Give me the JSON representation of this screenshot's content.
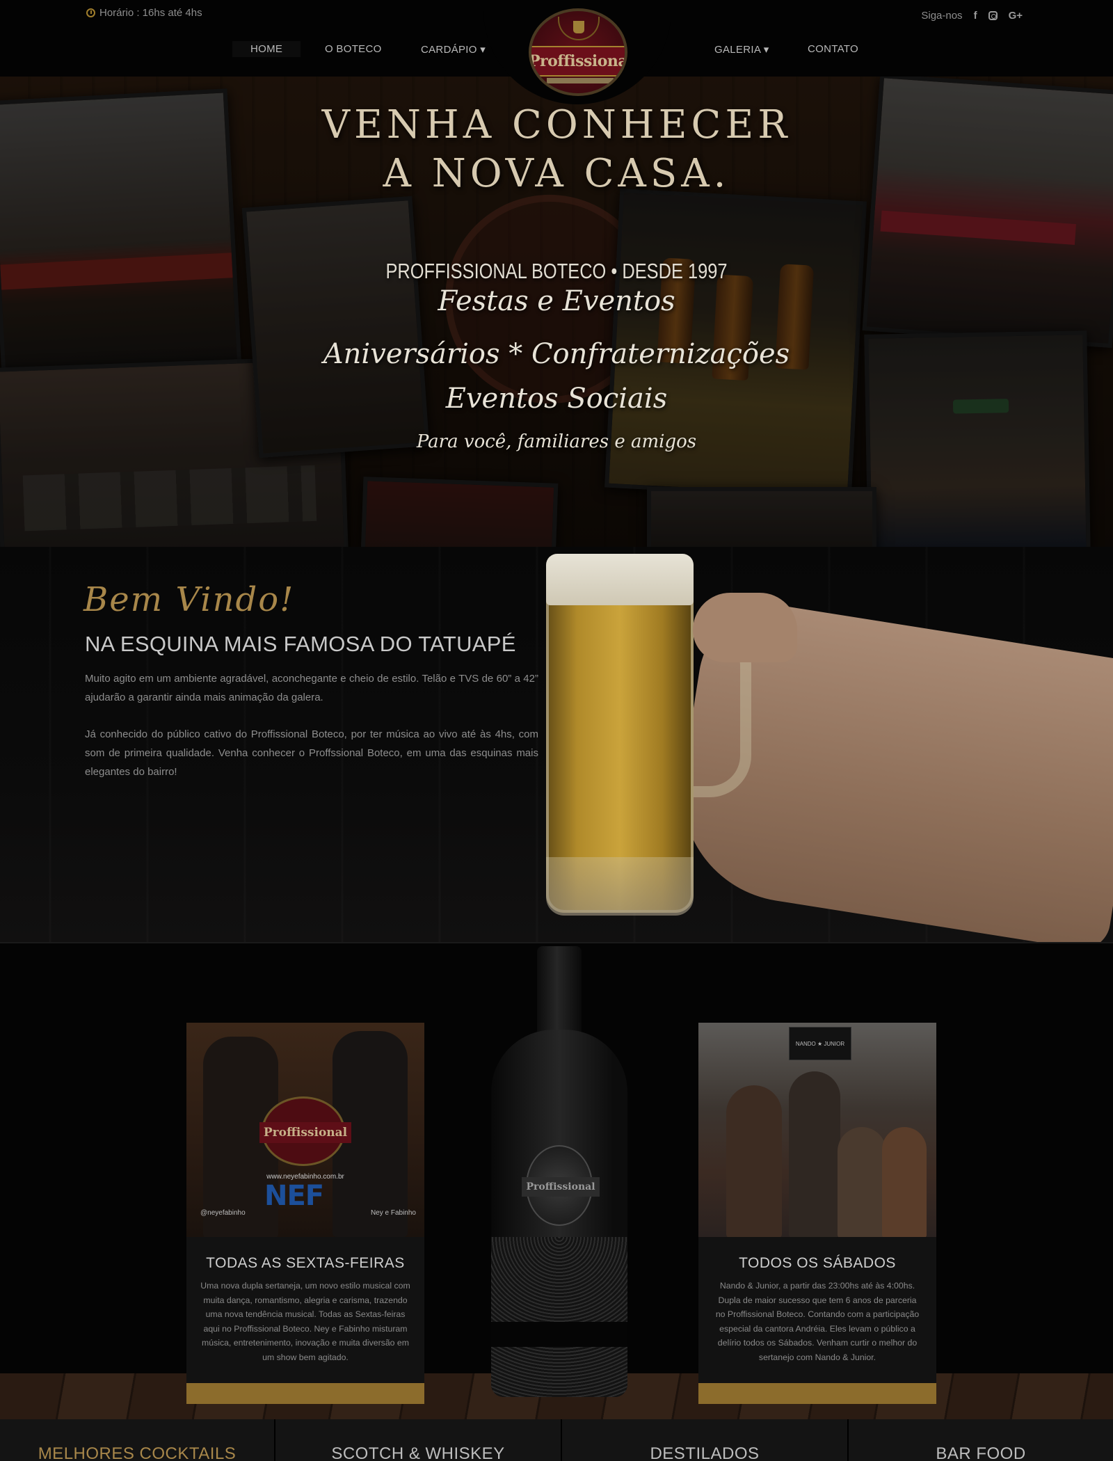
{
  "header": {
    "hours": "Horário : 16hs até 4hs",
    "follow_label": "Siga-nos",
    "nav": [
      "HOME",
      "O BOTECO",
      "CARDÁPIO ▾",
      "GALERIA ▾",
      "CONTATO"
    ],
    "logo_text": "Proffissional"
  },
  "hero": {
    "title_line1": "VENHA CONHECER",
    "title_line2": "A NOVA CASA.",
    "subtitle": "PROFFISSIONAL BOTECO • DESDE 1997",
    "script_line1": "Festas e Eventos",
    "script_line2": "Aniversários * Confraternizações",
    "script_line3": "Eventos Sociais",
    "script_line4": "Para você, familiares e amigos"
  },
  "welcome": {
    "script_title": "Bem Vindo!",
    "heading": "NA ESQUINA MAIS FAMOSA DO TATUAPÉ",
    "paragraph1": "Muito agito em um ambiente agradável, aconchegante e cheio de estilo. Telão e TVS de 60” a 42” ajudarão a garantir ainda mais animação da galera.",
    "paragraph2": "Já conhecido do público cativo do Proffissional Boteco, por ter música ao vivo até às 4hs, com som de primeira qualidade. Venha conhecer o Proffssional Boteco, em uma das esquinas mais elegantes do bairro!"
  },
  "events": {
    "friday": {
      "title": "TODAS AS SEXTAS-FEIRAS",
      "text": "Uma nova dupla sertaneja, um novo estilo musical com muita dança, romantismo, alegria e carisma, trazendo uma nova tendência musical. Todas as Sextas-feiras aqui no Proffissional Boteco. Ney e Fabinho misturam música, entretenimento, inovação e muita diversão em um show bem agitado.",
      "poster_logo": "Proffissional",
      "poster_url": "www.neyefabinho.com.br",
      "poster_brand": "NEF",
      "poster_handle_left": "@neyefabinho",
      "poster_handle_right": "Ney e Fabinho"
    },
    "saturday": {
      "title": "TODOS OS SÁBADOS",
      "text": "Nando & Junior, a partir das 23:00hs até às 4:00hs. Dupla de maior sucesso que tem 6 anos de parceria no Proffissional Boteco. Contando com a participação especial da cantora Andréia. Eles levam o público a delírio todos os Sábados. Venham curtir o melhor do sertanejo com Nando & Junior.",
      "sign_text": "NANDO ★ JUNIOR"
    },
    "bottle_label": "Proffissional"
  },
  "menu_strip": [
    "MELHORES COCKTAILS",
    "SCOTCH & WHISKEY",
    "DESTILADOS",
    "BAR FOOD"
  ],
  "colors": {
    "gold": "#a8874a",
    "background": "#050505",
    "logo_red": "#5e0f17"
  }
}
